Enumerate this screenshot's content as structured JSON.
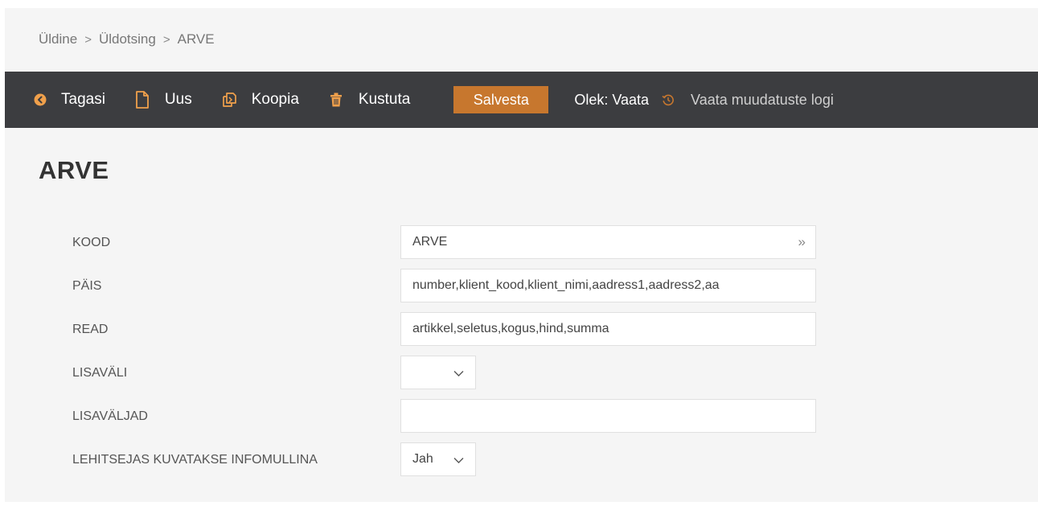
{
  "breadcrumb": {
    "items": [
      "Üldine",
      "Üldotsing",
      "ARVE"
    ],
    "separator": ">"
  },
  "toolbar": {
    "back_label": "Tagasi",
    "new_label": "Uus",
    "copy_label": "Koopia",
    "delete_label": "Kustuta",
    "save_label": "Salvesta",
    "status_text": "Olek: Vaata",
    "log_label": "Vaata muudatuste logi"
  },
  "page_title": "ARVE",
  "form": {
    "kood": {
      "label": "KOOD",
      "value": "ARVE",
      "action_glyph": "»"
    },
    "pais": {
      "label": "PÄIS",
      "value": "number,klient_kood,klient_nimi,aadress1,aadress2,aa"
    },
    "read": {
      "label": "READ",
      "value": "artikkel,seletus,kogus,hind,summa"
    },
    "lisavali": {
      "label": "LISAVÄLI",
      "value": ""
    },
    "lisavaljad": {
      "label": "LISAVÄLJAD",
      "value": ""
    },
    "infomull": {
      "label": "LEHITSEJAS KUVATAKSE INFOMULLINA",
      "value": "Jah"
    }
  },
  "colors": {
    "toolbar_bg": "#3c3d40",
    "save_button": "#c7772e",
    "page_bg": "#f5f5f5"
  },
  "icons": [
    "back-circle-icon",
    "new-document-icon",
    "copy-icon",
    "trash-icon",
    "history-icon",
    "chevron-down-icon"
  ]
}
